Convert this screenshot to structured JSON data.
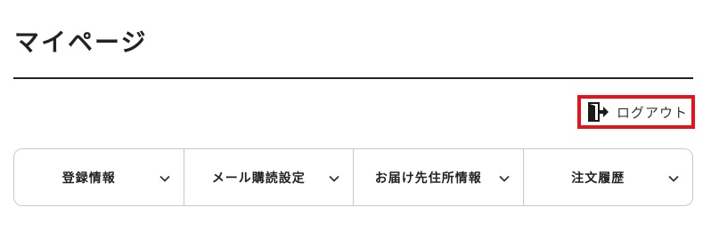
{
  "header": {
    "title": "マイページ"
  },
  "logout": {
    "label": "ログアウト",
    "icon": "logout-door-icon",
    "highlight_color": "#e3141b"
  },
  "tabs": [
    {
      "label": "登録情報",
      "icon": "chevron-down-icon"
    },
    {
      "label": "メール購読設定",
      "icon": "chevron-down-icon"
    },
    {
      "label": "お届け先住所情報",
      "icon": "chevron-down-icon"
    },
    {
      "label": "注文履歴",
      "icon": "chevron-down-icon"
    }
  ]
}
